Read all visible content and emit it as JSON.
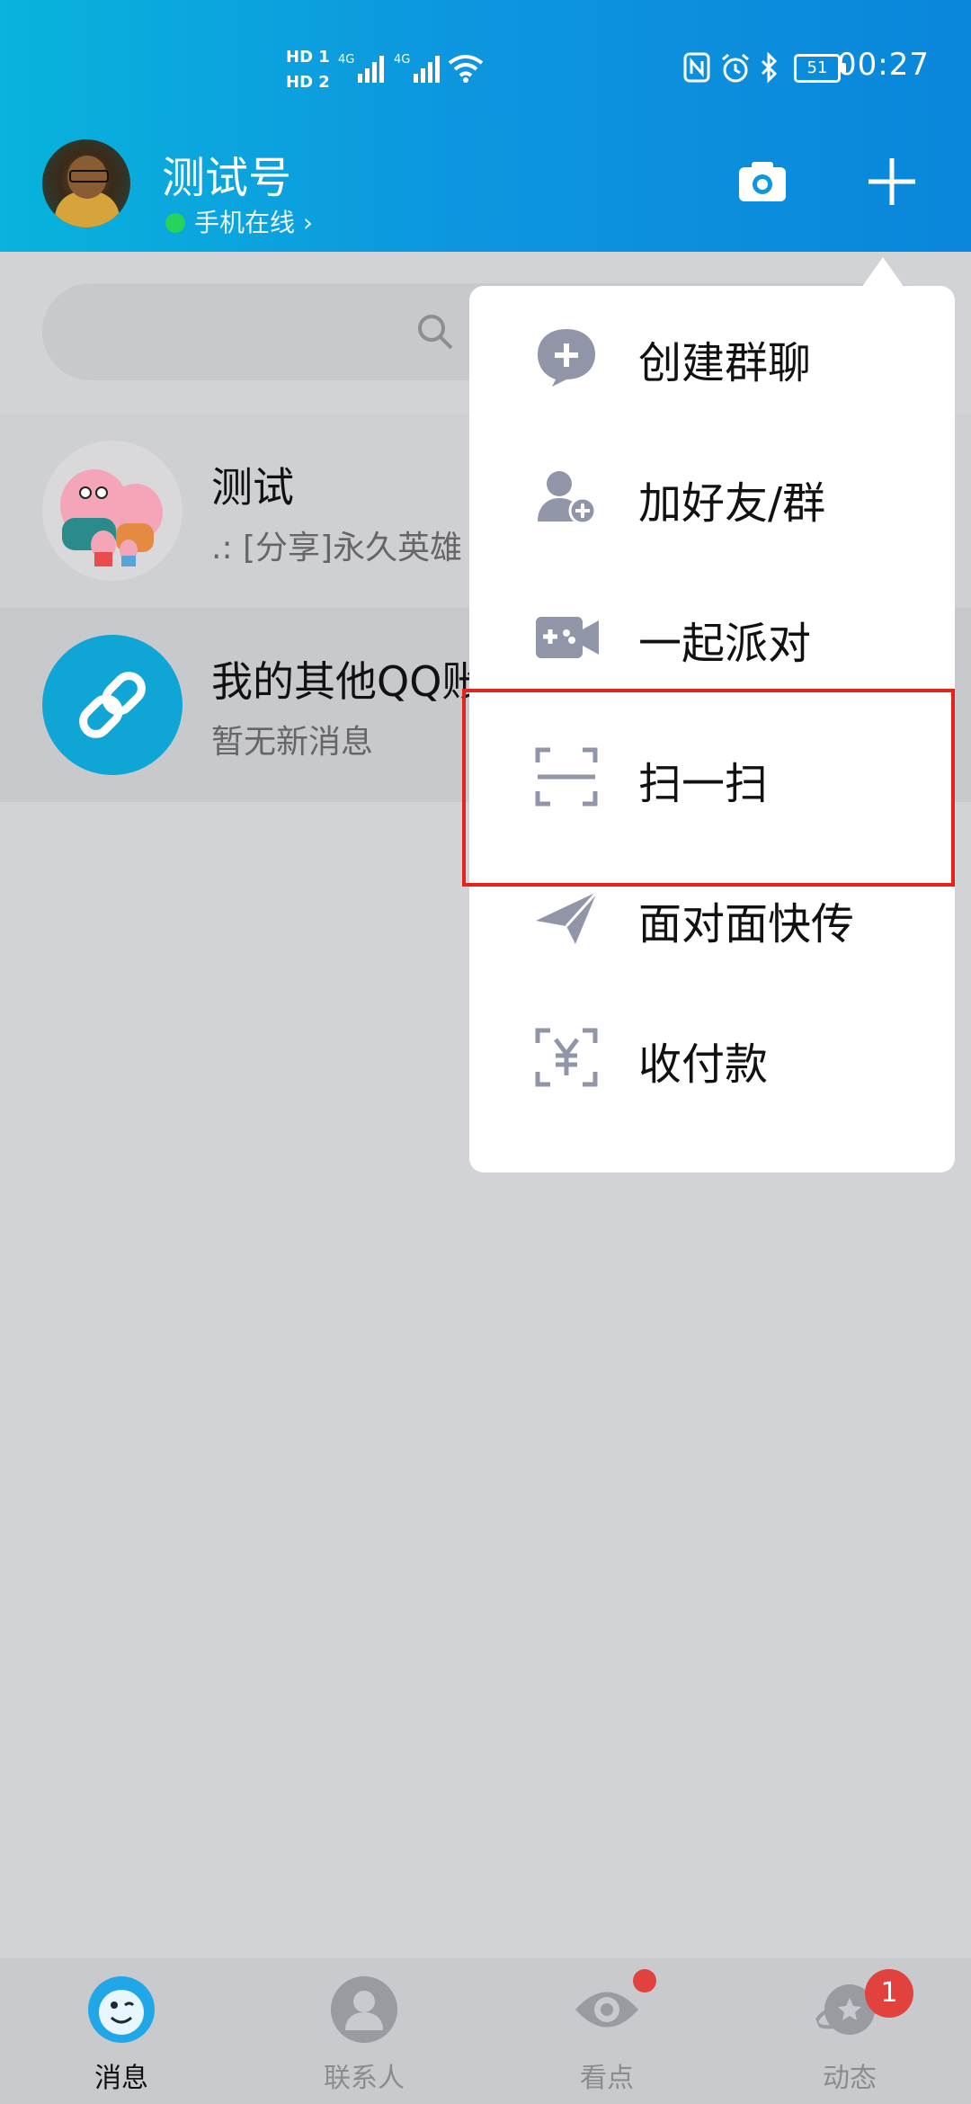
{
  "status_bar": {
    "hd1": "HD 1",
    "hd2": "HD 2",
    "net1": "4G",
    "net2": "4G",
    "battery": "51",
    "time": "00:27"
  },
  "header": {
    "username": "测试号",
    "online_status": "手机在线",
    "camera_icon": "camera-icon",
    "plus_icon": "plus-icon"
  },
  "search": {
    "icon": "search-icon"
  },
  "conversations": [
    {
      "title": "测试",
      "preview": ".: [分享]永久英雄"
    },
    {
      "title": "我的其他QQ账号",
      "preview": "暂无新消息"
    }
  ],
  "menu": {
    "items": [
      {
        "label": "创建群聊",
        "icon": "chat-plus-icon"
      },
      {
        "label": "加好友/群",
        "icon": "add-friend-icon"
      },
      {
        "label": "一起派对",
        "icon": "game-camera-icon"
      },
      {
        "label": "扫一扫",
        "icon": "scan-icon"
      },
      {
        "label": "面对面快传",
        "icon": "paper-plane-icon"
      },
      {
        "label": "收付款",
        "icon": "yuan-scan-icon"
      }
    ],
    "highlighted": "扫一扫",
    "highlight_color": "#e3231c"
  },
  "bottom_nav": {
    "items": [
      {
        "label": "消息",
        "active": true
      },
      {
        "label": "联系人",
        "active": false
      },
      {
        "label": "看点",
        "active": false,
        "dot": true
      },
      {
        "label": "动态",
        "active": false,
        "badge": "1"
      }
    ]
  },
  "colors": {
    "header_start": "#08b3dc",
    "header_end": "#0a86da",
    "badge": "#e2423d"
  }
}
